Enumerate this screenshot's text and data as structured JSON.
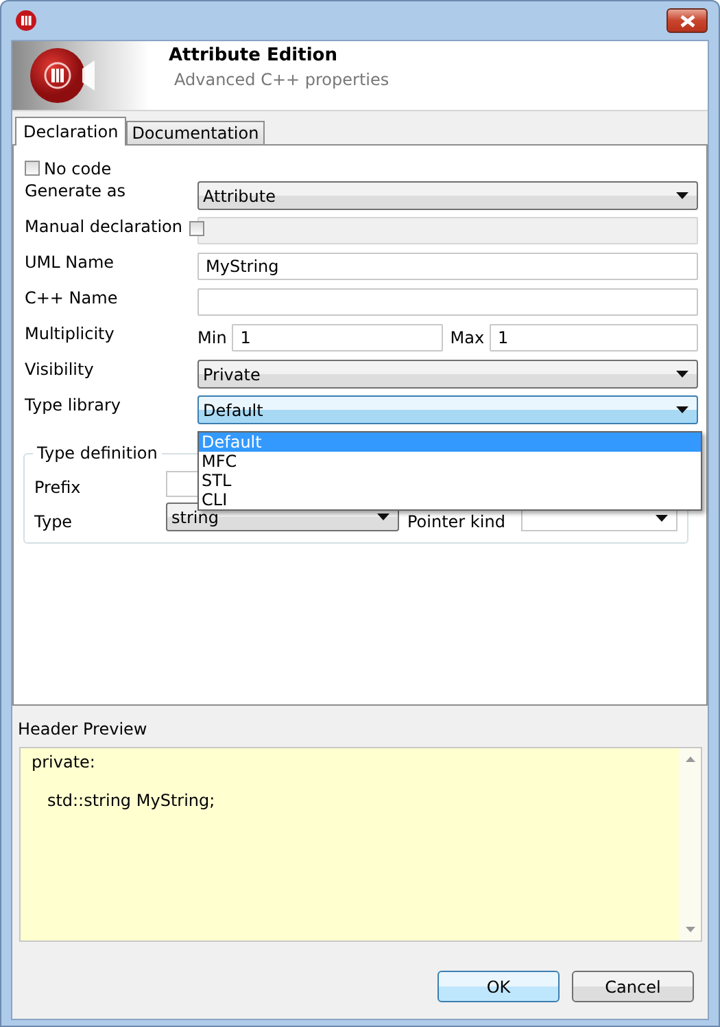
{
  "header": {
    "title": "Attribute Edition",
    "subtitle": "Advanced C++ properties"
  },
  "tabs": [
    {
      "label": "Declaration",
      "selected": true
    },
    {
      "label": "Documentation",
      "selected": false
    }
  ],
  "no_code": {
    "label": "No code",
    "checked": false
  },
  "rows": [
    {
      "kind": "combo",
      "label": "Generate as",
      "value": "Attribute"
    },
    {
      "kind": "checkfield",
      "label": "Manual declaration",
      "checked": false,
      "disabled": true
    },
    {
      "kind": "text",
      "label": "UML Name",
      "value": "MyString"
    },
    {
      "kind": "text",
      "label": "C++ Name"
    },
    {
      "kind": "minmax",
      "label": "Multiplicity",
      "min_label": "Min",
      "min_value": "1",
      "max_label": "Max",
      "max_value": "1"
    },
    {
      "kind": "combo",
      "label": "Visibility",
      "value": "Private"
    },
    {
      "kind": "combo",
      "label": "Type library",
      "value": "Default",
      "expanded": true,
      "options": [
        {
          "label": "Default",
          "selected": true
        },
        {
          "label": "MFC",
          "selected": false
        },
        {
          "label": "STL",
          "selected": false
        },
        {
          "label": "CLI",
          "selected": false
        }
      ]
    }
  ],
  "type_definition": {
    "title": "Type definition",
    "prefix_label": "Prefix",
    "type_label": "Type",
    "type_value": "string",
    "pointer_kind_label": "Pointer kind"
  },
  "header_preview": {
    "label": "Header Preview",
    "text": "private:\n\n   std::string MyString;"
  },
  "buttons": [
    {
      "label": "OK",
      "default": true
    },
    {
      "label": "Cancel",
      "default": false
    }
  ]
}
